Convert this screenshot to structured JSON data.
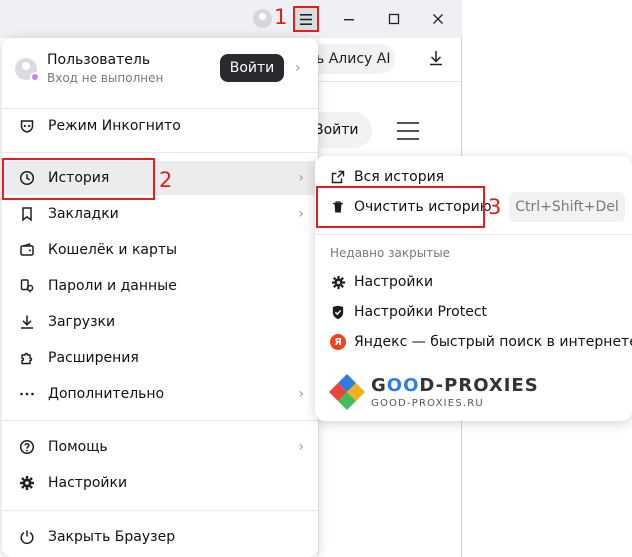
{
  "browser": {
    "bg_pill_text": "ь Алису AI",
    "bg_button_text": "Войти"
  },
  "annotations": {
    "n1": "1",
    "n2": "2",
    "n3": "3"
  },
  "menu": {
    "user": {
      "name": "Пользователь",
      "status": "Вход не выполнен",
      "login_label": "Войти"
    },
    "incognito": "Режим Инкогнито",
    "history": "История",
    "bookmarks": "Закладки",
    "wallet": "Кошелёк и карты",
    "passwords": "Пароли и данные",
    "downloads": "Загрузки",
    "extensions": "Расширения",
    "more": "Дополнительно",
    "help": "Помощь",
    "settings": "Настройки",
    "close_browser": "Закрыть Браузер"
  },
  "submenu": {
    "all_history": "Вся история",
    "clear_history": "Очистить историю",
    "shortcut": "Ctrl+Shift+Del",
    "recent_header": "Недавно закрытые",
    "recent": [
      "Настройки",
      "Настройки Protect",
      "Яндекс — быстрый поиск в интернете"
    ]
  },
  "watermark": {
    "title_g": "G",
    "title_oo": "OO",
    "title_rest": "D-PROXIES",
    "url": "GOOD-PROXIES.RU"
  },
  "colors": {
    "highlight": "#e02020",
    "login_button": "#2a2a2e",
    "yandex": "#fc3f1d"
  }
}
